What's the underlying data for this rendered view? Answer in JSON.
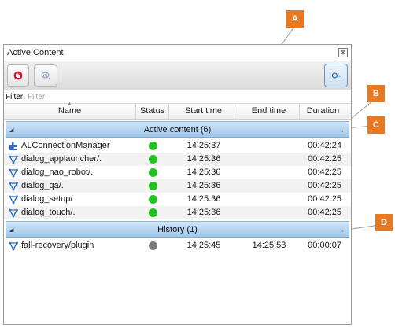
{
  "callouts": {
    "a": "A",
    "b": "B",
    "c": "C",
    "d": "D",
    "color": "#e9781f"
  },
  "window": {
    "title": "Active Content",
    "close_glyph": "⊠"
  },
  "toolbar": {
    "stop_icon": "stop-behaviors-icon",
    "robot_icon": "robot-select-icon",
    "search_icon": "search-toggle-icon"
  },
  "filter": {
    "label": "Filter:",
    "placeholder": "Filter:"
  },
  "columns": {
    "name": "Name",
    "status": "Status",
    "start": "Start time",
    "end": "End time",
    "duration": "Duration"
  },
  "groups": {
    "active": {
      "label": "Active content (6)",
      "rows": [
        {
          "icon": "puzzle-icon",
          "name": "ALConnectionManager",
          "status": "running",
          "start": "14:25:37",
          "end": "",
          "duration": "00:42:24"
        },
        {
          "icon": "behavior-icon",
          "name": "dialog_applauncher/.",
          "status": "running",
          "start": "14:25:36",
          "end": "",
          "duration": "00:42:25"
        },
        {
          "icon": "behavior-icon",
          "name": "dialog_nao_robot/.",
          "status": "running",
          "start": "14:25:36",
          "end": "",
          "duration": "00:42:25"
        },
        {
          "icon": "behavior-icon",
          "name": "dialog_qa/.",
          "status": "running",
          "start": "14:25:36",
          "end": "",
          "duration": "00:42:25"
        },
        {
          "icon": "behavior-icon",
          "name": "dialog_setup/.",
          "status": "running",
          "start": "14:25:36",
          "end": "",
          "duration": "00:42:25"
        },
        {
          "icon": "behavior-icon",
          "name": "dialog_touch/.",
          "status": "running",
          "start": "14:25:36",
          "end": "",
          "duration": "00:42:25"
        }
      ]
    },
    "history": {
      "label": "History (1)",
      "rows": [
        {
          "icon": "behavior-icon",
          "name": "fall-recovery/plugin",
          "status": "stopped",
          "start": "14:25:45",
          "end": "14:25:53",
          "duration": "00:00:07"
        }
      ]
    }
  },
  "colors": {
    "running": "#1fc21f",
    "stopped": "#7a7a7a",
    "group_band": "#9ec8ea"
  }
}
